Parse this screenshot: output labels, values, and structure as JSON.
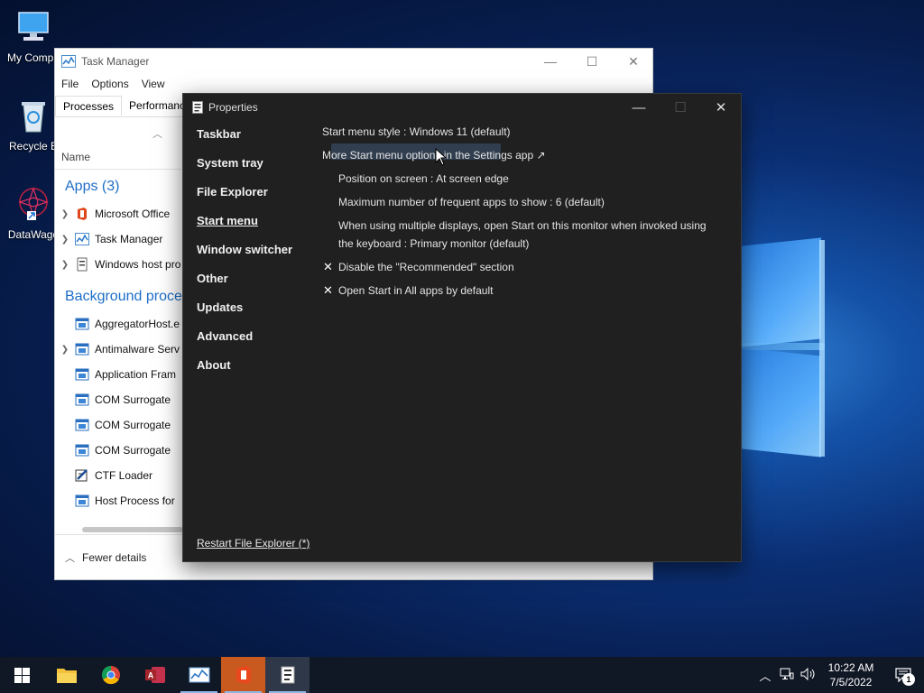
{
  "desktop": {
    "icons": [
      {
        "label": "My Compu",
        "icon": "computer-icon"
      },
      {
        "label": "Recycle B",
        "icon": "recycle-bin-icon"
      },
      {
        "label": "DataWago",
        "icon": "datawagon-icon"
      }
    ]
  },
  "task_manager": {
    "title": "Task Manager",
    "menu": [
      "File",
      "Options",
      "View"
    ],
    "tabs": [
      "Processes",
      "Performance"
    ],
    "column_name": "Name",
    "groups": {
      "apps": "Apps (3)",
      "background": "Background proces"
    },
    "apps": [
      "Microsoft Office",
      "Task Manager",
      "Windows host pro"
    ],
    "background": [
      "AggregatorHost.e",
      "Antimalware Serv",
      "Application Fram",
      "COM Surrogate",
      "COM Surrogate",
      "COM Surrogate",
      "CTF Loader",
      "Host Process for"
    ],
    "footer_label": "Fewer details"
  },
  "properties": {
    "title": "Properties",
    "nav": [
      "Taskbar",
      "System tray",
      "File Explorer",
      "Start menu",
      "Window switcher",
      "Other",
      "Updates",
      "Advanced",
      "About"
    ],
    "active_nav": "Start menu",
    "options": {
      "style": "Start menu style : Windows 11 (default)",
      "more_link": "More Start menu options in the Settings app ↗",
      "position": "Position on screen : At screen edge",
      "max_apps": "Maximum number of frequent apps to show : 6 (default)",
      "multi_line1": "When using multiple displays, open Start on this monitor when invoked using",
      "multi_line2": "the keyboard : Primary monitor (default)",
      "disable_recommended": "Disable the \"Recommended\" section",
      "open_all_apps": "Open Start in All apps by default"
    },
    "check_mark": "✕",
    "restart_link": "Restart File Explorer (*)"
  },
  "taskbar": {
    "apps": [
      "start-icon",
      "file-explorer-icon",
      "chrome-icon",
      "access-icon",
      "task-manager-icon",
      "office-icon",
      "properties-icon"
    ],
    "clock_time": "10:22 AM",
    "clock_date": "7/5/2022",
    "notification_count": "1"
  }
}
